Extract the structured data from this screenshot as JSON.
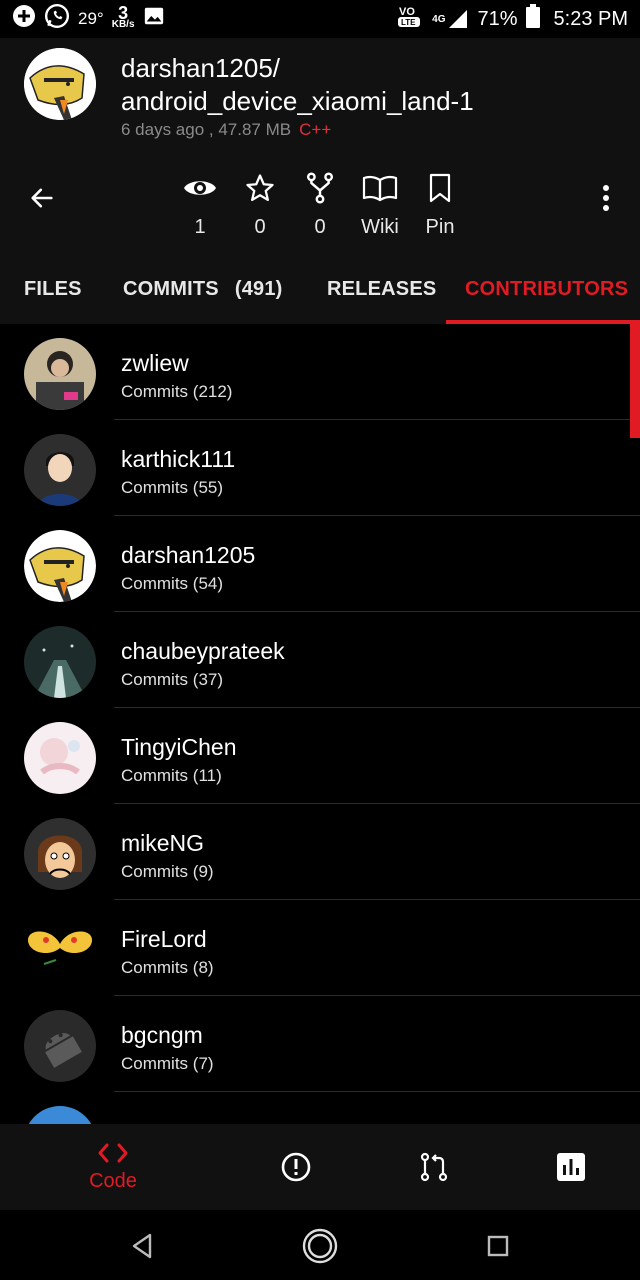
{
  "status_bar": {
    "temperature": "29°",
    "speed_value": "3",
    "speed_unit": "KB/s",
    "network": "4G",
    "battery": "71%",
    "time": "5:23 PM"
  },
  "repo": {
    "title_line1": "darshan1205/",
    "title_line2": "android_device_xiaomi_land-1",
    "meta": "6 days ago , 47.87 MB",
    "language": "C++"
  },
  "stats": {
    "watchers": "1",
    "stars": "0",
    "forks": "0",
    "wiki_label": "Wiki",
    "pin_label": "Pin"
  },
  "tabs": {
    "files": "FILES",
    "commits": "COMMITS",
    "commits_count": "(491)",
    "releases": "RELEASES",
    "contributors": "CONTRIBUTORS"
  },
  "contributors": [
    {
      "name": "zwliew",
      "commits": "Commits (212)"
    },
    {
      "name": "karthick111",
      "commits": "Commits (55)"
    },
    {
      "name": "darshan1205",
      "commits": "Commits (54)"
    },
    {
      "name": "chaubeyprateek",
      "commits": "Commits (37)"
    },
    {
      "name": "TingyiChen",
      "commits": "Commits (11)"
    },
    {
      "name": "mikeNG",
      "commits": "Commits (9)"
    },
    {
      "name": "FireLord",
      "commits": "Commits (8)"
    },
    {
      "name": "bgcngm",
      "commits": "Commits (7)"
    }
  ],
  "bottom_nav": {
    "code_label": "Code"
  },
  "colors": {
    "accent": "#e01b24",
    "header_bg": "#111111",
    "background": "#000000"
  }
}
